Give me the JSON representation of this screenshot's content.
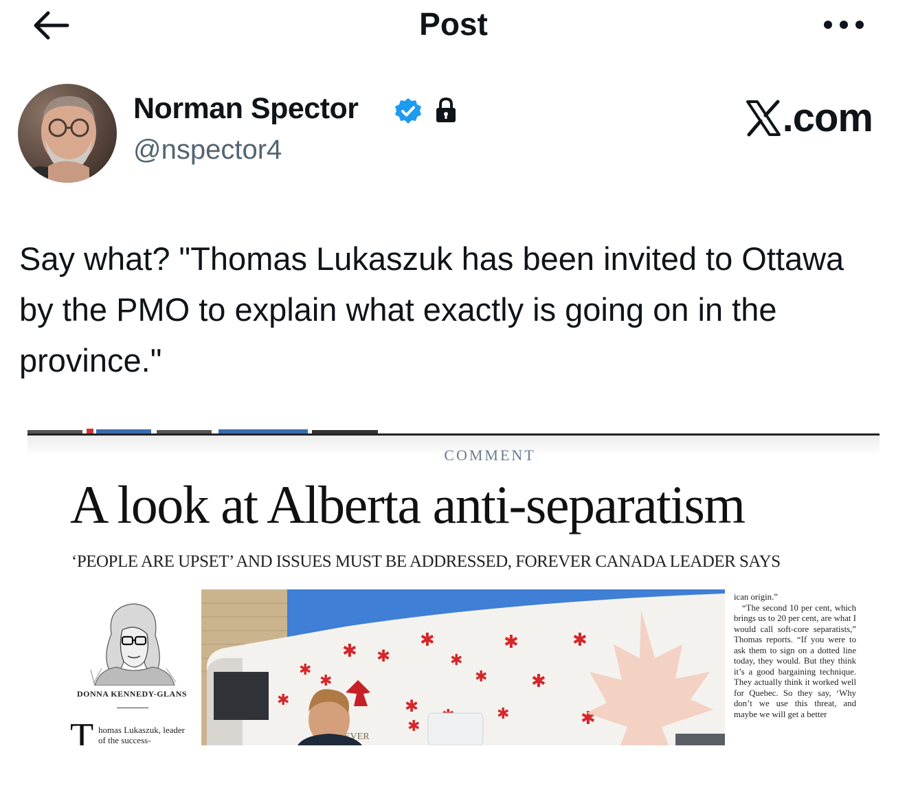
{
  "header": {
    "title": "Post",
    "back_icon": "arrow-left-icon",
    "more_icon": "more-horizontal-icon"
  },
  "author": {
    "name": "Norman Spector",
    "handle": "@nspector4",
    "badges": [
      "verified-icon",
      "lock-icon"
    ],
    "verified_color": "#1d9bf0"
  },
  "watermark": {
    "x_logo": "𝕏",
    "text": ".com"
  },
  "tweet": {
    "text": "Say what? \"Thomas Lukaszuk has been invited to Ottawa by the PMO to explain what exactly is going on in the province.\""
  },
  "article": {
    "kicker": "COMMENT",
    "headline": "A look at Alberta anti-separatism",
    "deck": "‘PEOPLE ARE UPSET’ AND ISSUES MUST BE ADDRESSED, FOREVER CANADA LEADER SAYS",
    "byline": "DONNA KENNEDY-GLANS",
    "dropcap": "T",
    "lede": "homas Lukaszuk, leader of the success-",
    "photo_van_text": "EVER",
    "column_paragraphs": [
      "ican origin.”",
      "“The second 10 per cent, which brings us to 20 per cent, are what I would call soft-core separatists,” Thomas reports. “If you were to ask them to sign on a dotted line today, they would. But they think it’s a good bargaining technique. They actually think it worked well for Quebec. So they say, ‘Why don’t we use this threat, and maybe we will get a better"
    ]
  },
  "colors": {
    "text": "#0f1419",
    "secondary": "#536471",
    "accent": "#1d9bf0",
    "kicker": "#6a7d90"
  }
}
